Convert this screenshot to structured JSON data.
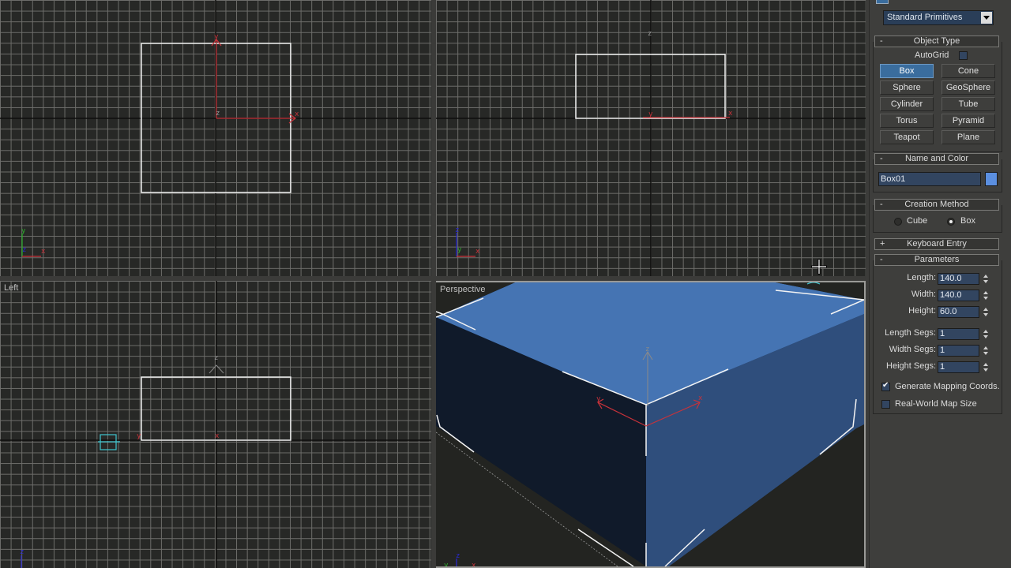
{
  "viewports": {
    "top": {
      "label": "",
      "axes": {
        "x": "x",
        "y": "y",
        "z": "z"
      }
    },
    "front": {
      "label": "",
      "axes": {
        "x": "x",
        "y": "y",
        "z": "z"
      }
    },
    "left": {
      "label": "Left",
      "axes": {
        "x": "x",
        "y": "y",
        "z": "z"
      }
    },
    "perspective": {
      "label": "Perspective",
      "axes": {
        "x": "x",
        "y": "y",
        "z": "z"
      }
    }
  },
  "colors": {
    "box_top": "#4574b3",
    "box_side_dark": "#101a2a",
    "box_side_light": "#2f4e7c",
    "axis_red": "#c8323a",
    "axis_green": "#2db02d",
    "axis_blue": "#2a2ad6",
    "selection_cyan": "#3fc6d0"
  },
  "panel": {
    "category_dropdown": "Standard Primitives",
    "object_type": {
      "title": "Object Type",
      "sign": "-",
      "autogrid_label": "AutoGrid",
      "autogrid_checked": false,
      "buttons": [
        {
          "label": "Box",
          "active": true
        },
        {
          "label": "Cone",
          "active": false
        },
        {
          "label": "Sphere",
          "active": false
        },
        {
          "label": "GeoSphere",
          "active": false
        },
        {
          "label": "Cylinder",
          "active": false
        },
        {
          "label": "Tube",
          "active": false
        },
        {
          "label": "Torus",
          "active": false
        },
        {
          "label": "Pyramid",
          "active": false
        },
        {
          "label": "Teapot",
          "active": false
        },
        {
          "label": "Plane",
          "active": false
        }
      ]
    },
    "name_and_color": {
      "title": "Name and Color",
      "sign": "-",
      "name_value": "Box01",
      "color": "#5b8fe0"
    },
    "creation_method": {
      "title": "Creation Method",
      "sign": "-",
      "options": [
        {
          "label": "Cube",
          "checked": false
        },
        {
          "label": "Box",
          "checked": true
        }
      ]
    },
    "keyboard_entry": {
      "title": "Keyboard Entry",
      "sign": "+"
    },
    "parameters": {
      "title": "Parameters",
      "sign": "-",
      "fields": [
        {
          "label": "Length:",
          "value": "140.0"
        },
        {
          "label": "Width:",
          "value": "140.0"
        },
        {
          "label": "Height:",
          "value": "60.0"
        },
        {
          "label": "Length Segs:",
          "value": "1"
        },
        {
          "label": "Width Segs:",
          "value": "1"
        },
        {
          "label": "Height Segs:",
          "value": "1"
        }
      ],
      "checkboxes": [
        {
          "label": "Generate Mapping Coords.",
          "checked": true
        },
        {
          "label": "Real-World Map Size",
          "checked": false
        }
      ]
    }
  }
}
